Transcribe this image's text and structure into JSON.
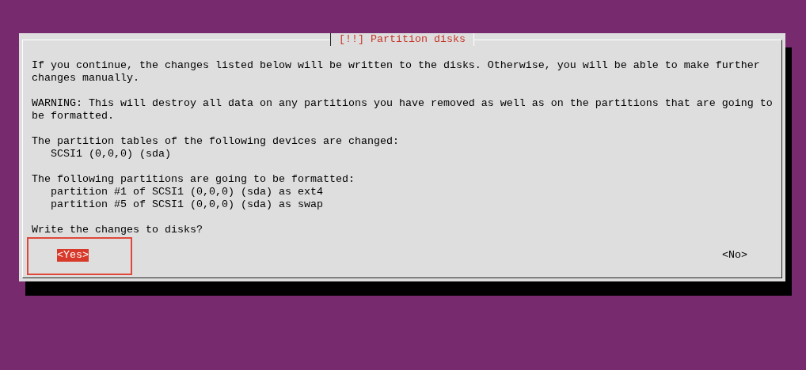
{
  "window": {
    "title": "[!!] Partition disks"
  },
  "paragraphs": [
    {
      "text": "If you continue, the changes listed below will be written to the disks. Otherwise, you will be able to make further changes manually."
    },
    {
      "text": "WARNING: This will destroy all data on any partitions you have removed as well as on the partitions that are going to be formatted."
    },
    {
      "text": "The partition tables of the following devices are changed:",
      "items": [
        "SCSI1 (0,0,0) (sda)"
      ]
    },
    {
      "text": "The following partitions are going to be formatted:",
      "items": [
        "partition #1 of SCSI1 (0,0,0) (sda) as ext4",
        "partition #5 of SCSI1 (0,0,0) (sda) as swap"
      ]
    }
  ],
  "question": "Write the changes to disks?",
  "buttons": [
    {
      "label": "<Yes>",
      "selected": true
    },
    {
      "label": "<No>",
      "selected": false
    }
  ]
}
